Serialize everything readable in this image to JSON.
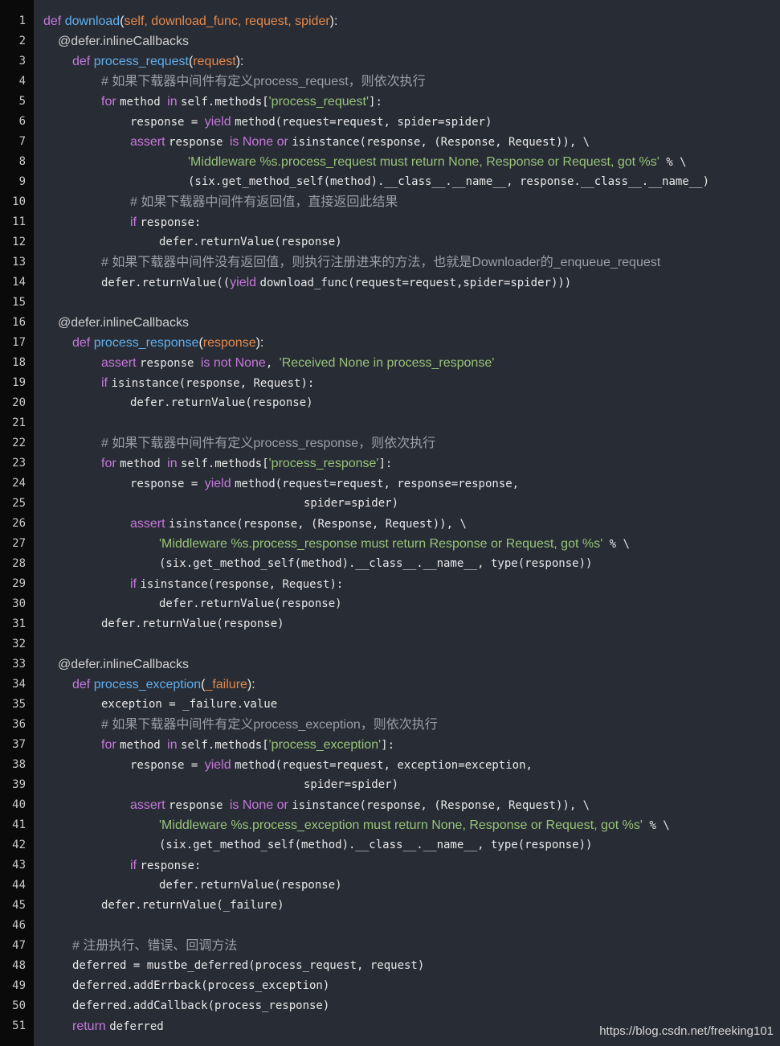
{
  "colors": {
    "background": "#282c34",
    "gutter": "#0a0a0a",
    "keyword": "#c678dd",
    "string": "#98c379",
    "comment": "#9aa0a6",
    "function": "#61afef",
    "param": "#e5894b"
  },
  "watermark": "https://blog.csdn.net/freeking101",
  "lines": [
    {
      "n": "1",
      "indent": 0,
      "tokens": [
        [
          "def ",
          "kw sans"
        ],
        [
          "download",
          "fn sans"
        ],
        [
          "(",
          "plain sans"
        ],
        [
          "self, download_func, request, spider",
          "param sans"
        ],
        [
          "):",
          "plain sans"
        ]
      ]
    },
    {
      "n": "2",
      "indent": 1,
      "tokens": [
        [
          "@defer.inlineCallbacks",
          "dec sans"
        ]
      ]
    },
    {
      "n": "3",
      "indent": 2,
      "tokens": [
        [
          "def ",
          "kw sans"
        ],
        [
          "process_request",
          "fn sans"
        ],
        [
          "(",
          "plain sans"
        ],
        [
          "request",
          "param sans"
        ],
        [
          "):",
          "plain sans"
        ]
      ]
    },
    {
      "n": "4",
      "indent": 4,
      "tokens": [
        [
          "# 如果下载器中间件有定义process_request，则依次执行",
          "cmt sans"
        ]
      ]
    },
    {
      "n": "5",
      "indent": 4,
      "tokens": [
        [
          "for ",
          "kw sans"
        ],
        [
          "method ",
          "plain"
        ],
        [
          "in ",
          "kw sans"
        ],
        [
          "self.methods[",
          "plain"
        ],
        [
          "'process_request'",
          "str sans"
        ],
        [
          "]:",
          "plain"
        ]
      ]
    },
    {
      "n": "6",
      "indent": 6,
      "tokens": [
        [
          "response = ",
          "plain"
        ],
        [
          "yield ",
          "kw sans"
        ],
        [
          "method(request=request, spider=spider)",
          "plain"
        ]
      ]
    },
    {
      "n": "7",
      "indent": 6,
      "tokens": [
        [
          "assert ",
          "kw sans"
        ],
        [
          "response ",
          "plain"
        ],
        [
          "is ",
          "kw sans"
        ],
        [
          "None ",
          "kw sans"
        ],
        [
          "or ",
          "kw sans"
        ],
        [
          "isinstance(response, (Response, Request)), \\",
          "plain"
        ]
      ]
    },
    {
      "n": "8",
      "indent": 10,
      "tokens": [
        [
          "'Middleware %s.process_request must return None, Response or Request, got %s'",
          "str sans"
        ],
        [
          " % \\",
          "plain"
        ]
      ]
    },
    {
      "n": "9",
      "indent": 10,
      "tokens": [
        [
          "(six.get_method_self(method).__class__.__name__, response.__class__.__name__)",
          "plain"
        ]
      ]
    },
    {
      "n": "10",
      "indent": 6,
      "tokens": [
        [
          "# 如果下载器中间件有返回值，直接返回此结果",
          "cmt sans"
        ]
      ]
    },
    {
      "n": "11",
      "indent": 6,
      "tokens": [
        [
          "if ",
          "kw sans"
        ],
        [
          "response:",
          "plain"
        ]
      ]
    },
    {
      "n": "12",
      "indent": 8,
      "tokens": [
        [
          "defer.returnValue(response)",
          "plain"
        ]
      ]
    },
    {
      "n": "13",
      "indent": 4,
      "tokens": [
        [
          "# 如果下载器中间件没有返回值，则执行注册进来的方法，也就是Downloader的_enqueue_request",
          "cmt sans"
        ]
      ]
    },
    {
      "n": "14",
      "indent": 4,
      "tokens": [
        [
          "defer.returnValue((",
          "plain"
        ],
        [
          "yield ",
          "kw sans"
        ],
        [
          "download_func(request=request,spider=spider)))",
          "plain"
        ]
      ]
    },
    {
      "n": "15",
      "indent": 0,
      "tokens": []
    },
    {
      "n": "16",
      "indent": 1,
      "tokens": [
        [
          "@defer.inlineCallbacks",
          "dec sans"
        ]
      ]
    },
    {
      "n": "17",
      "indent": 2,
      "tokens": [
        [
          "def ",
          "kw sans"
        ],
        [
          "process_response",
          "fn sans"
        ],
        [
          "(",
          "plain sans"
        ],
        [
          "response",
          "param sans"
        ],
        [
          "):",
          "plain sans"
        ]
      ]
    },
    {
      "n": "18",
      "indent": 4,
      "tokens": [
        [
          "assert ",
          "kw sans"
        ],
        [
          "response ",
          "plain"
        ],
        [
          "is ",
          "kw sans"
        ],
        [
          "not ",
          "kw sans"
        ],
        [
          "None",
          "kw sans"
        ],
        [
          ", ",
          "plain"
        ],
        [
          "'Received None in process_response'",
          "str sans"
        ]
      ]
    },
    {
      "n": "19",
      "indent": 4,
      "tokens": [
        [
          "if ",
          "kw sans"
        ],
        [
          "isinstance(response, Request):",
          "plain"
        ]
      ]
    },
    {
      "n": "20",
      "indent": 6,
      "tokens": [
        [
          "defer.returnValue(response)",
          "plain"
        ]
      ]
    },
    {
      "n": "21",
      "indent": 0,
      "tokens": []
    },
    {
      "n": "22",
      "indent": 4,
      "tokens": [
        [
          "# 如果下载器中间件有定义process_response，则依次执行",
          "cmt sans"
        ]
      ]
    },
    {
      "n": "23",
      "indent": 4,
      "tokens": [
        [
          "for ",
          "kw sans"
        ],
        [
          "method ",
          "plain"
        ],
        [
          "in ",
          "kw sans"
        ],
        [
          "self.methods[",
          "plain"
        ],
        [
          "'process_response'",
          "str sans"
        ],
        [
          "]:",
          "plain"
        ]
      ]
    },
    {
      "n": "24",
      "indent": 6,
      "tokens": [
        [
          "response = ",
          "plain"
        ],
        [
          "yield ",
          "kw sans"
        ],
        [
          "method(request=request, response=response,",
          "plain"
        ]
      ]
    },
    {
      "n": "25",
      "indent": 18,
      "tokens": [
        [
          "spider=spider)",
          "plain"
        ]
      ]
    },
    {
      "n": "26",
      "indent": 6,
      "tokens": [
        [
          "assert ",
          "kw sans"
        ],
        [
          "isinstance(response, (Response, Request)), \\",
          "plain"
        ]
      ]
    },
    {
      "n": "27",
      "indent": 8,
      "tokens": [
        [
          "'Middleware %s.process_response must return Response or Request, got %s'",
          "str sans"
        ],
        [
          " % \\",
          "plain"
        ]
      ]
    },
    {
      "n": "28",
      "indent": 8,
      "tokens": [
        [
          "(six.get_method_self(method).__class__.__name__, type(response))",
          "plain"
        ]
      ]
    },
    {
      "n": "29",
      "indent": 6,
      "tokens": [
        [
          "if ",
          "kw sans"
        ],
        [
          "isinstance(response, Request):",
          "plain"
        ]
      ]
    },
    {
      "n": "30",
      "indent": 8,
      "tokens": [
        [
          "defer.returnValue(response)",
          "plain"
        ]
      ]
    },
    {
      "n": "31",
      "indent": 4,
      "tokens": [
        [
          "defer.returnValue(response)",
          "plain"
        ]
      ]
    },
    {
      "n": "32",
      "indent": 0,
      "tokens": []
    },
    {
      "n": "33",
      "indent": 1,
      "tokens": [
        [
          "@defer.inlineCallbacks",
          "dec sans"
        ]
      ]
    },
    {
      "n": "34",
      "indent": 2,
      "tokens": [
        [
          "def ",
          "kw sans"
        ],
        [
          "process_exception",
          "fn sans"
        ],
        [
          "(",
          "plain sans"
        ],
        [
          "_failure",
          "param sans"
        ],
        [
          "):",
          "plain sans"
        ]
      ]
    },
    {
      "n": "35",
      "indent": 4,
      "tokens": [
        [
          "exception = _failure.value",
          "plain"
        ]
      ]
    },
    {
      "n": "36",
      "indent": 4,
      "tokens": [
        [
          "# 如果下载器中间件有定义process_exception，则依次执行",
          "cmt sans"
        ]
      ]
    },
    {
      "n": "37",
      "indent": 4,
      "tokens": [
        [
          "for ",
          "kw sans"
        ],
        [
          "method ",
          "plain"
        ],
        [
          "in ",
          "kw sans"
        ],
        [
          "self.methods[",
          "plain"
        ],
        [
          "'process_exception'",
          "str sans"
        ],
        [
          "]:",
          "plain"
        ]
      ]
    },
    {
      "n": "38",
      "indent": 6,
      "tokens": [
        [
          "response = ",
          "plain"
        ],
        [
          "yield ",
          "kw sans"
        ],
        [
          "method(request=request, exception=exception,",
          "plain"
        ]
      ]
    },
    {
      "n": "39",
      "indent": 18,
      "tokens": [
        [
          "spider=spider)",
          "plain"
        ]
      ]
    },
    {
      "n": "40",
      "indent": 6,
      "tokens": [
        [
          "assert ",
          "kw sans"
        ],
        [
          "response ",
          "plain"
        ],
        [
          "is ",
          "kw sans"
        ],
        [
          "None ",
          "kw sans"
        ],
        [
          "or ",
          "kw sans"
        ],
        [
          "isinstance(response, (Response, Request)), \\",
          "plain"
        ]
      ]
    },
    {
      "n": "41",
      "indent": 8,
      "tokens": [
        [
          "'Middleware %s.process_exception must return None, Response or Request, got %s'",
          "str sans"
        ],
        [
          " % \\",
          "plain"
        ]
      ]
    },
    {
      "n": "42",
      "indent": 8,
      "tokens": [
        [
          "(six.get_method_self(method).__class__.__name__, type(response))",
          "plain"
        ]
      ]
    },
    {
      "n": "43",
      "indent": 6,
      "tokens": [
        [
          "if ",
          "kw sans"
        ],
        [
          "response:",
          "plain"
        ]
      ]
    },
    {
      "n": "44",
      "indent": 8,
      "tokens": [
        [
          "defer.returnValue(response)",
          "plain"
        ]
      ]
    },
    {
      "n": "45",
      "indent": 4,
      "tokens": [
        [
          "defer.returnValue(_failure)",
          "plain"
        ]
      ]
    },
    {
      "n": "46",
      "indent": 0,
      "tokens": []
    },
    {
      "n": "47",
      "indent": 2,
      "tokens": [
        [
          "# 注册执行、错误、回调方法",
          "cmt sans"
        ]
      ]
    },
    {
      "n": "48",
      "indent": 2,
      "tokens": [
        [
          "deferred = mustbe_deferred(process_request, request)",
          "plain"
        ]
      ]
    },
    {
      "n": "49",
      "indent": 2,
      "tokens": [
        [
          "deferred.addErrback(process_exception)",
          "plain"
        ]
      ]
    },
    {
      "n": "50",
      "indent": 2,
      "tokens": [
        [
          "deferred.addCallback(process_response)",
          "plain"
        ]
      ]
    },
    {
      "n": "51",
      "indent": 2,
      "tokens": [
        [
          "return ",
          "kw sans"
        ],
        [
          "deferred",
          "plain"
        ]
      ]
    }
  ]
}
